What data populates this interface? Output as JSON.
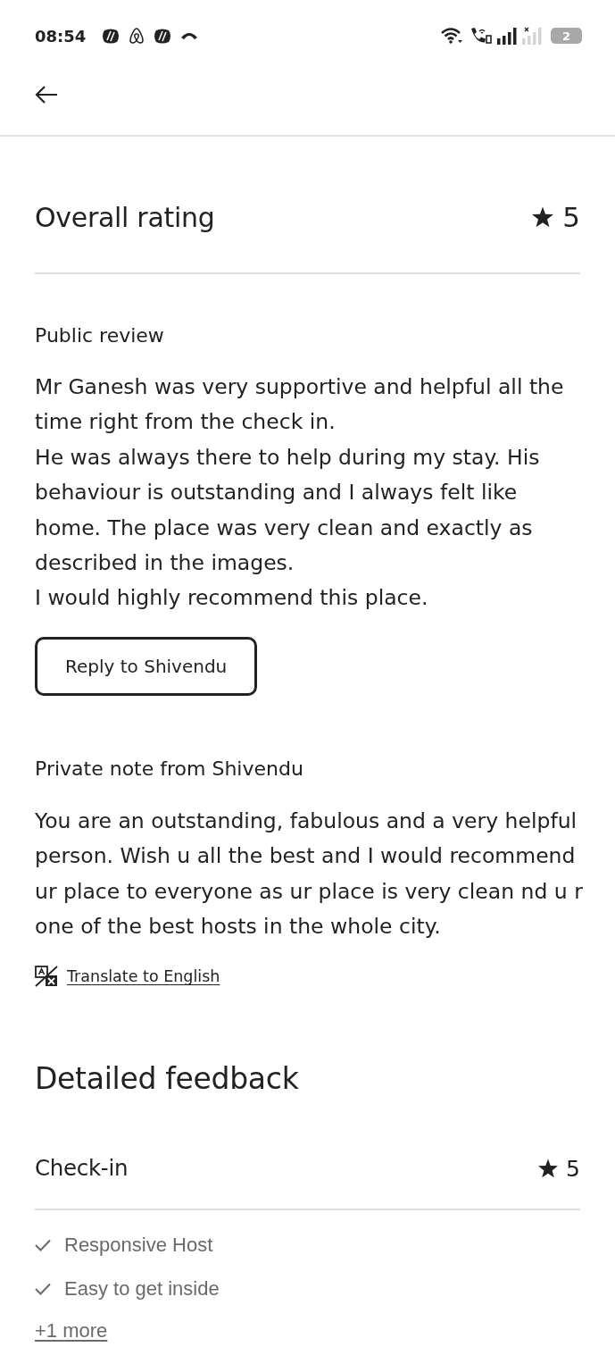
{
  "status_bar": {
    "time": "08:54",
    "battery": "2"
  },
  "overall_rating": {
    "title": "Overall rating",
    "rating": "5"
  },
  "public_review": {
    "title": "Public review",
    "text": "Mr Ganesh was very supportive and helpful all the time right from the check in.\nHe was always there to help during my stay. His behaviour is outstanding and I always felt like home. The place was very clean and exactly as described in the images.\nI would highly recommend this place.",
    "reply_button": "Reply to Shivendu"
  },
  "private_note": {
    "title": "Private note from Shivendu",
    "text": "You are an outstanding, fabulous and a very helpful person. Wish u all the best and I would recommend ur place to everyone as ur place is very clean nd u r one of the best hosts in the whole city.",
    "translate_link": "Translate to English"
  },
  "detailed_feedback": {
    "title": "Detailed feedback",
    "categories": [
      {
        "name": "Check-in",
        "rating": "5",
        "tags": [
          "Responsive Host",
          "Easy to get inside"
        ],
        "more_link": "+1 more"
      }
    ]
  }
}
